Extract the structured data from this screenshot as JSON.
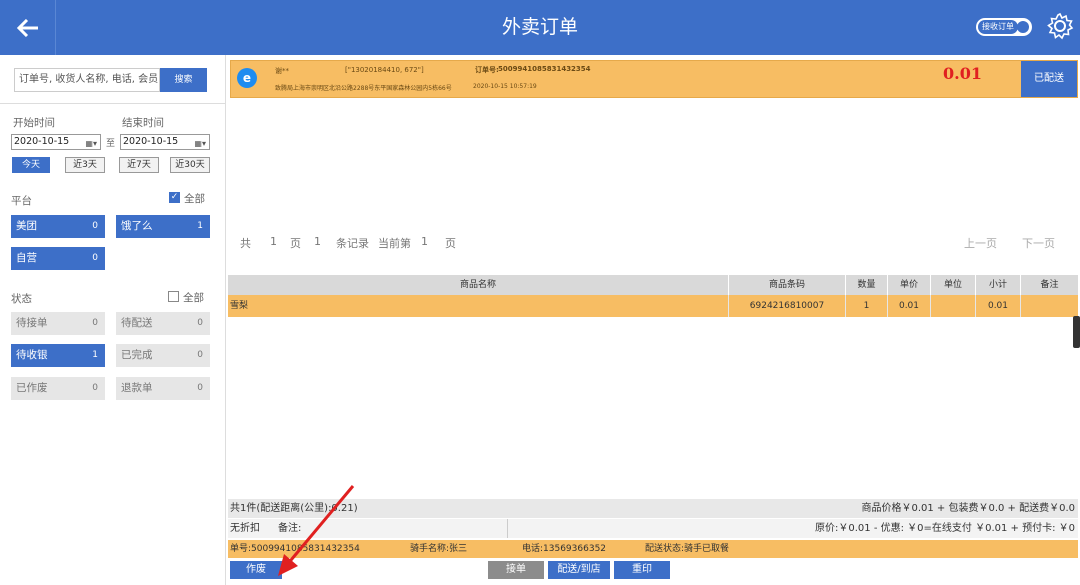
{
  "header": {
    "title": "外卖订单",
    "accept_order_label": "接收订单"
  },
  "search": {
    "placeholder": "订单号, 收货人名称, 电话, 会员",
    "button": "搜索"
  },
  "date_filter": {
    "start_label": "开始时间",
    "end_label": "结束时间",
    "start_date": "2020-10-15",
    "end_date": "2020-10-15",
    "separator": "至",
    "ranges": [
      "今天",
      "近3天",
      "近7天",
      "近30天"
    ]
  },
  "platform": {
    "label": "平台",
    "all_label": "全部",
    "all_checked": true,
    "items": [
      {
        "name": "美团",
        "count": "0"
      },
      {
        "name": "饿了么",
        "count": "1"
      },
      {
        "name": "自营",
        "count": "0"
      }
    ]
  },
  "status": {
    "label": "状态",
    "all_label": "全部",
    "all_checked": false,
    "items": [
      {
        "name": "待接单",
        "count": "0"
      },
      {
        "name": "待配送",
        "count": "0"
      },
      {
        "name": "待收银",
        "count": "1"
      },
      {
        "name": "已完成",
        "count": "0"
      },
      {
        "name": "已作废",
        "count": "0"
      },
      {
        "name": "退款单",
        "count": "0"
      }
    ]
  },
  "order_card": {
    "customer": "谢**",
    "phones": "[\"13020184410, 672\"]",
    "order_no_label": "订单号:",
    "order_no": "5009941085831432354",
    "address": "致腾局上海市崇明区北沿公路2288号东平国家森林公园内5栋66号",
    "time": "2020-10-15 10:57:19",
    "amount": "0.01",
    "deliver_button": "已配送"
  },
  "pager": {
    "total_prefix": "共",
    "pages": "1",
    "page_unit": "页",
    "records": "1",
    "record_unit": "条记录",
    "current_label": "当前第",
    "current": "1",
    "current_unit": "页",
    "prev": "上一页",
    "next": "下一页"
  },
  "table": {
    "headers": [
      "商品名称",
      "商品条码",
      "数量",
      "单价",
      "单位",
      "小计",
      "备注"
    ],
    "rows": [
      {
        "name": "雪梨",
        "barcode": "6924216810007",
        "qty": "1",
        "price": "0.01",
        "unit": "",
        "subtotal": "0.01",
        "note": ""
      }
    ]
  },
  "summary": {
    "count_distance": "共1件(配送距离(公里):0.21)",
    "price_breakdown": "商品价格￥0.01 + 包装费￥0.0 + 配送费￥0.0",
    "discount": "无折扣",
    "note_label": "备注:",
    "payment_breakdown": "原价:￥0.01 - 优惠: ￥0=在线支付 ￥0.01 + 预付卡: ￥0"
  },
  "status_bar": {
    "order_no": "单号:5009941085831432354",
    "rider": "骑手名称:张三",
    "phone": "电话:13569366352",
    "delivery_status": "配送状态:骑手已取餐"
  },
  "actions": {
    "void": "作废",
    "accept": "接单",
    "deliver": "配送/到店",
    "reprint": "重印"
  },
  "colors": {
    "primary": "#3d6fc8",
    "highlight": "#f7bd63",
    "amount": "#e02020"
  }
}
